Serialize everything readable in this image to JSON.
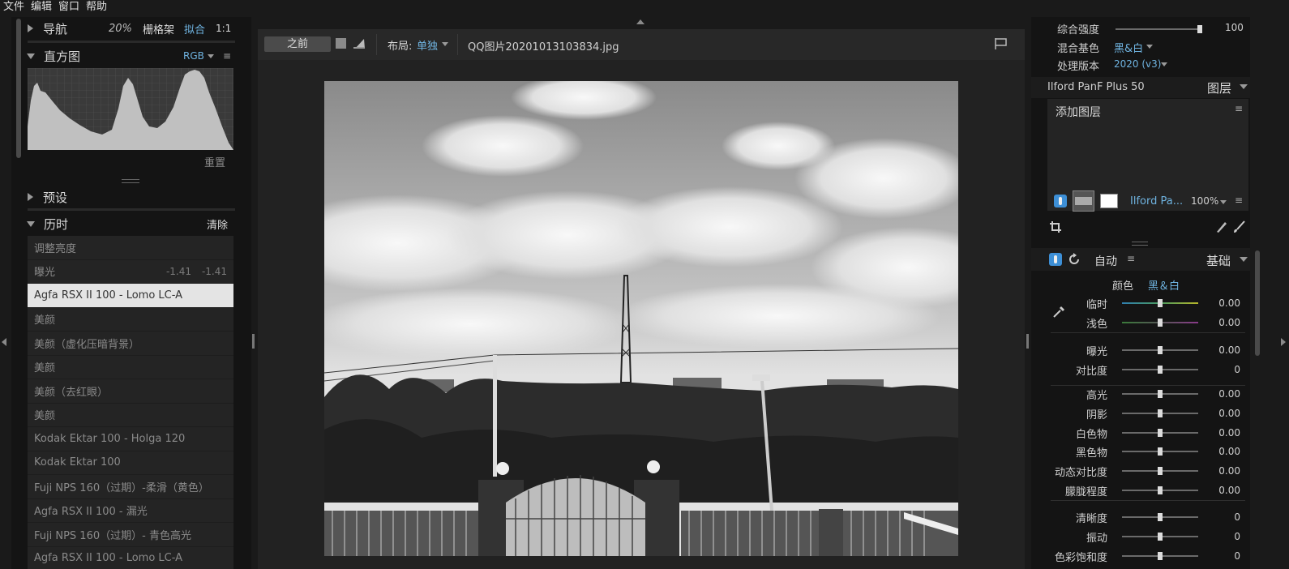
{
  "menu": [
    "文件",
    "编辑",
    "窗口",
    "帮助"
  ],
  "navigator": {
    "title": "导航",
    "zoom": "20%",
    "grid": "栅格架",
    "fit": "拟合",
    "one_to_one": "1:1"
  },
  "histogram": {
    "title": "直方图",
    "channel": "RGB",
    "reset": "重置"
  },
  "presets": {
    "title": "预设"
  },
  "history": {
    "title": "历时",
    "clear": "清除",
    "items": [
      {
        "label": "调整亮度"
      },
      {
        "label": "曝光",
        "v1": "-1.41",
        "v2": "-1.41"
      },
      {
        "label": "Agfa RSX II 100 - Lomo LC-A",
        "selected": true
      },
      {
        "label": "美颜"
      },
      {
        "label": "美颜（虚化压暗背景）"
      },
      {
        "label": "美颜"
      },
      {
        "label": "美颜（去红眼）"
      },
      {
        "label": "美颜"
      },
      {
        "label": "Kodak Ektar 100 - Holga 120"
      },
      {
        "label": "Kodak Ektar 100"
      },
      {
        "label": "Fuji NPS 160（过期）-柔滑（黄色）"
      },
      {
        "label": "Agfa RSX II 100 - 漏光"
      },
      {
        "label": "Fuji NPS 160（过期）- 青色高光"
      },
      {
        "label": "Agfa RSX II 100 - Lomo LC-A"
      }
    ]
  },
  "toolbar": {
    "before": "之前",
    "layout_label": "布局:",
    "layout_value": "单独",
    "filename": "QQ图片20201013103834.jpg"
  },
  "blend": {
    "strength_label": "综合强度",
    "strength_value": "100",
    "strength_level": 1.0,
    "base_label": "混合基色",
    "base_value": "黑&白",
    "version_label": "处理版本",
    "version_value": "2020 (v3)"
  },
  "layers": {
    "preset_name": "Ilford PanF Plus 50",
    "title": "图层",
    "add_layer": "添加图层",
    "layer_name": "Ilford Pa...",
    "opacity": "100%"
  },
  "basic": {
    "auto": "自动",
    "title": "基础",
    "color_label": "颜色",
    "color_value": "黑＆白",
    "sliders": [
      {
        "label": "临时",
        "value": "0.00",
        "level": 0.5,
        "track": "temp"
      },
      {
        "label": "浅色",
        "value": "0.00",
        "level": 0.5,
        "track": "tint"
      },
      {
        "label": "曝光",
        "value": "0.00",
        "level": 0.5
      },
      {
        "label": "对比度",
        "value": "0",
        "level": 0.5
      },
      {
        "label": "高光",
        "value": "0.00",
        "level": 0.5
      },
      {
        "label": "阴影",
        "value": "0.00",
        "level": 0.5
      },
      {
        "label": "白色物",
        "value": "0.00",
        "level": 0.5
      },
      {
        "label": "黑色物",
        "value": "0.00",
        "level": 0.5
      },
      {
        "label": "动态对比度",
        "value": "0.00",
        "level": 0.5
      },
      {
        "label": "朦胧程度",
        "value": "0.00",
        "level": 0.5
      },
      {
        "label": "清晰度",
        "value": "0",
        "level": 0.5
      },
      {
        "label": "振动",
        "value": "0",
        "level": 0.5
      },
      {
        "label": "色彩饱和度",
        "value": "0",
        "level": 0.5
      }
    ]
  },
  "colors": {
    "accent": "#6fb3e0",
    "toggle": "#3d8fd6"
  }
}
